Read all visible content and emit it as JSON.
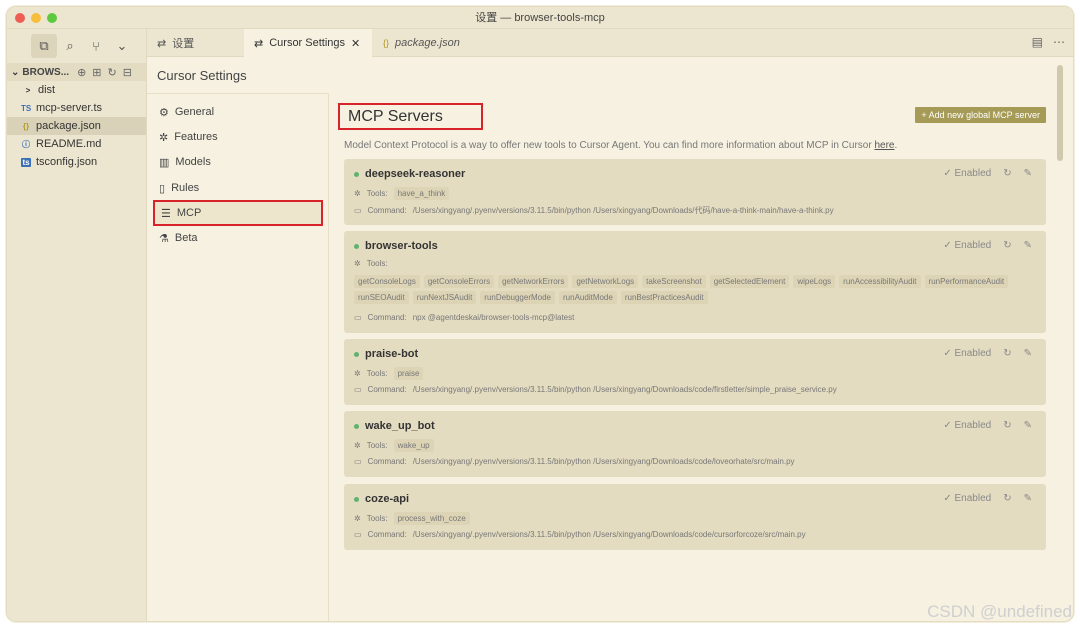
{
  "window": {
    "title": "设置 — browser-tools-mcp"
  },
  "explorer": {
    "root": "BROWS...",
    "items": [
      {
        "icon": ">",
        "label": "dist"
      },
      {
        "icon": "TS",
        "label": "mcp-server.ts"
      },
      {
        "icon": "{}",
        "label": "package.json"
      },
      {
        "icon": "ⓘ",
        "label": "README.md"
      },
      {
        "icon": "ts",
        "label": "tsconfig.json"
      }
    ]
  },
  "tabs": [
    {
      "icon": "⇄",
      "label": "设置"
    },
    {
      "icon": "⇄",
      "label": "Cursor Settings",
      "close": "✕"
    },
    {
      "icon": "{}",
      "label": "package.json"
    }
  ],
  "settings": {
    "title": "Cursor Settings",
    "nav": [
      "General",
      "Features",
      "Models",
      "Rules",
      "MCP",
      "Beta"
    ]
  },
  "mcp": {
    "title": "MCP Servers",
    "add_button": "+ Add new global MCP server",
    "description": "Model Context Protocol is a way to offer new tools to Cursor Agent. You can find more information about MCP in Cursor",
    "description_link": "here",
    "enabled_label": "Enabled",
    "tools_label": "Tools:",
    "command_label": "Command:",
    "servers": [
      {
        "name": "deepseek-reasoner",
        "tools": [
          "have_a_think"
        ],
        "command": "/Users/xingyang/.pyenv/versions/3.11.5/bin/python /Users/xingyang/Downloads/代码/have-a-think-main/have-a-think.py"
      },
      {
        "name": "browser-tools",
        "tools": [
          "getConsoleLogs",
          "getConsoleErrors",
          "getNetworkErrors",
          "getNetworkLogs",
          "takeScreenshot",
          "getSelectedElement",
          "wipeLogs",
          "runAccessibilityAudit",
          "runPerformanceAudit",
          "runSEOAudit",
          "runNextJSAudit",
          "runDebuggerMode",
          "runAuditMode",
          "runBestPracticesAudit"
        ],
        "command": "npx @agentdeskai/browser-tools-mcp@latest"
      },
      {
        "name": "praise-bot",
        "tools": [
          "praise"
        ],
        "command": "/Users/xingyang/.pyenv/versions/3.11.5/bin/python /Users/xingyang/Downloads/code/firstletter/simple_praise_service.py"
      },
      {
        "name": "wake_up_bot",
        "tools": [
          "wake_up"
        ],
        "command": "/Users/xingyang/.pyenv/versions/3.11.5/bin/python /Users/xingyang/Downloads/code/loveorhate/src/main.py"
      },
      {
        "name": "coze-api",
        "tools": [
          "process_with_coze"
        ],
        "command": "/Users/xingyang/.pyenv/versions/3.11.5/bin/python /Users/xingyang/Downloads/code/cursorforcoze/src/main.py"
      }
    ]
  },
  "watermark": "CSDN @undefined",
  "colors": {
    "accent_red": "#d8232a",
    "status_green": "#5fb36f",
    "button_olive": "#a59b57"
  }
}
